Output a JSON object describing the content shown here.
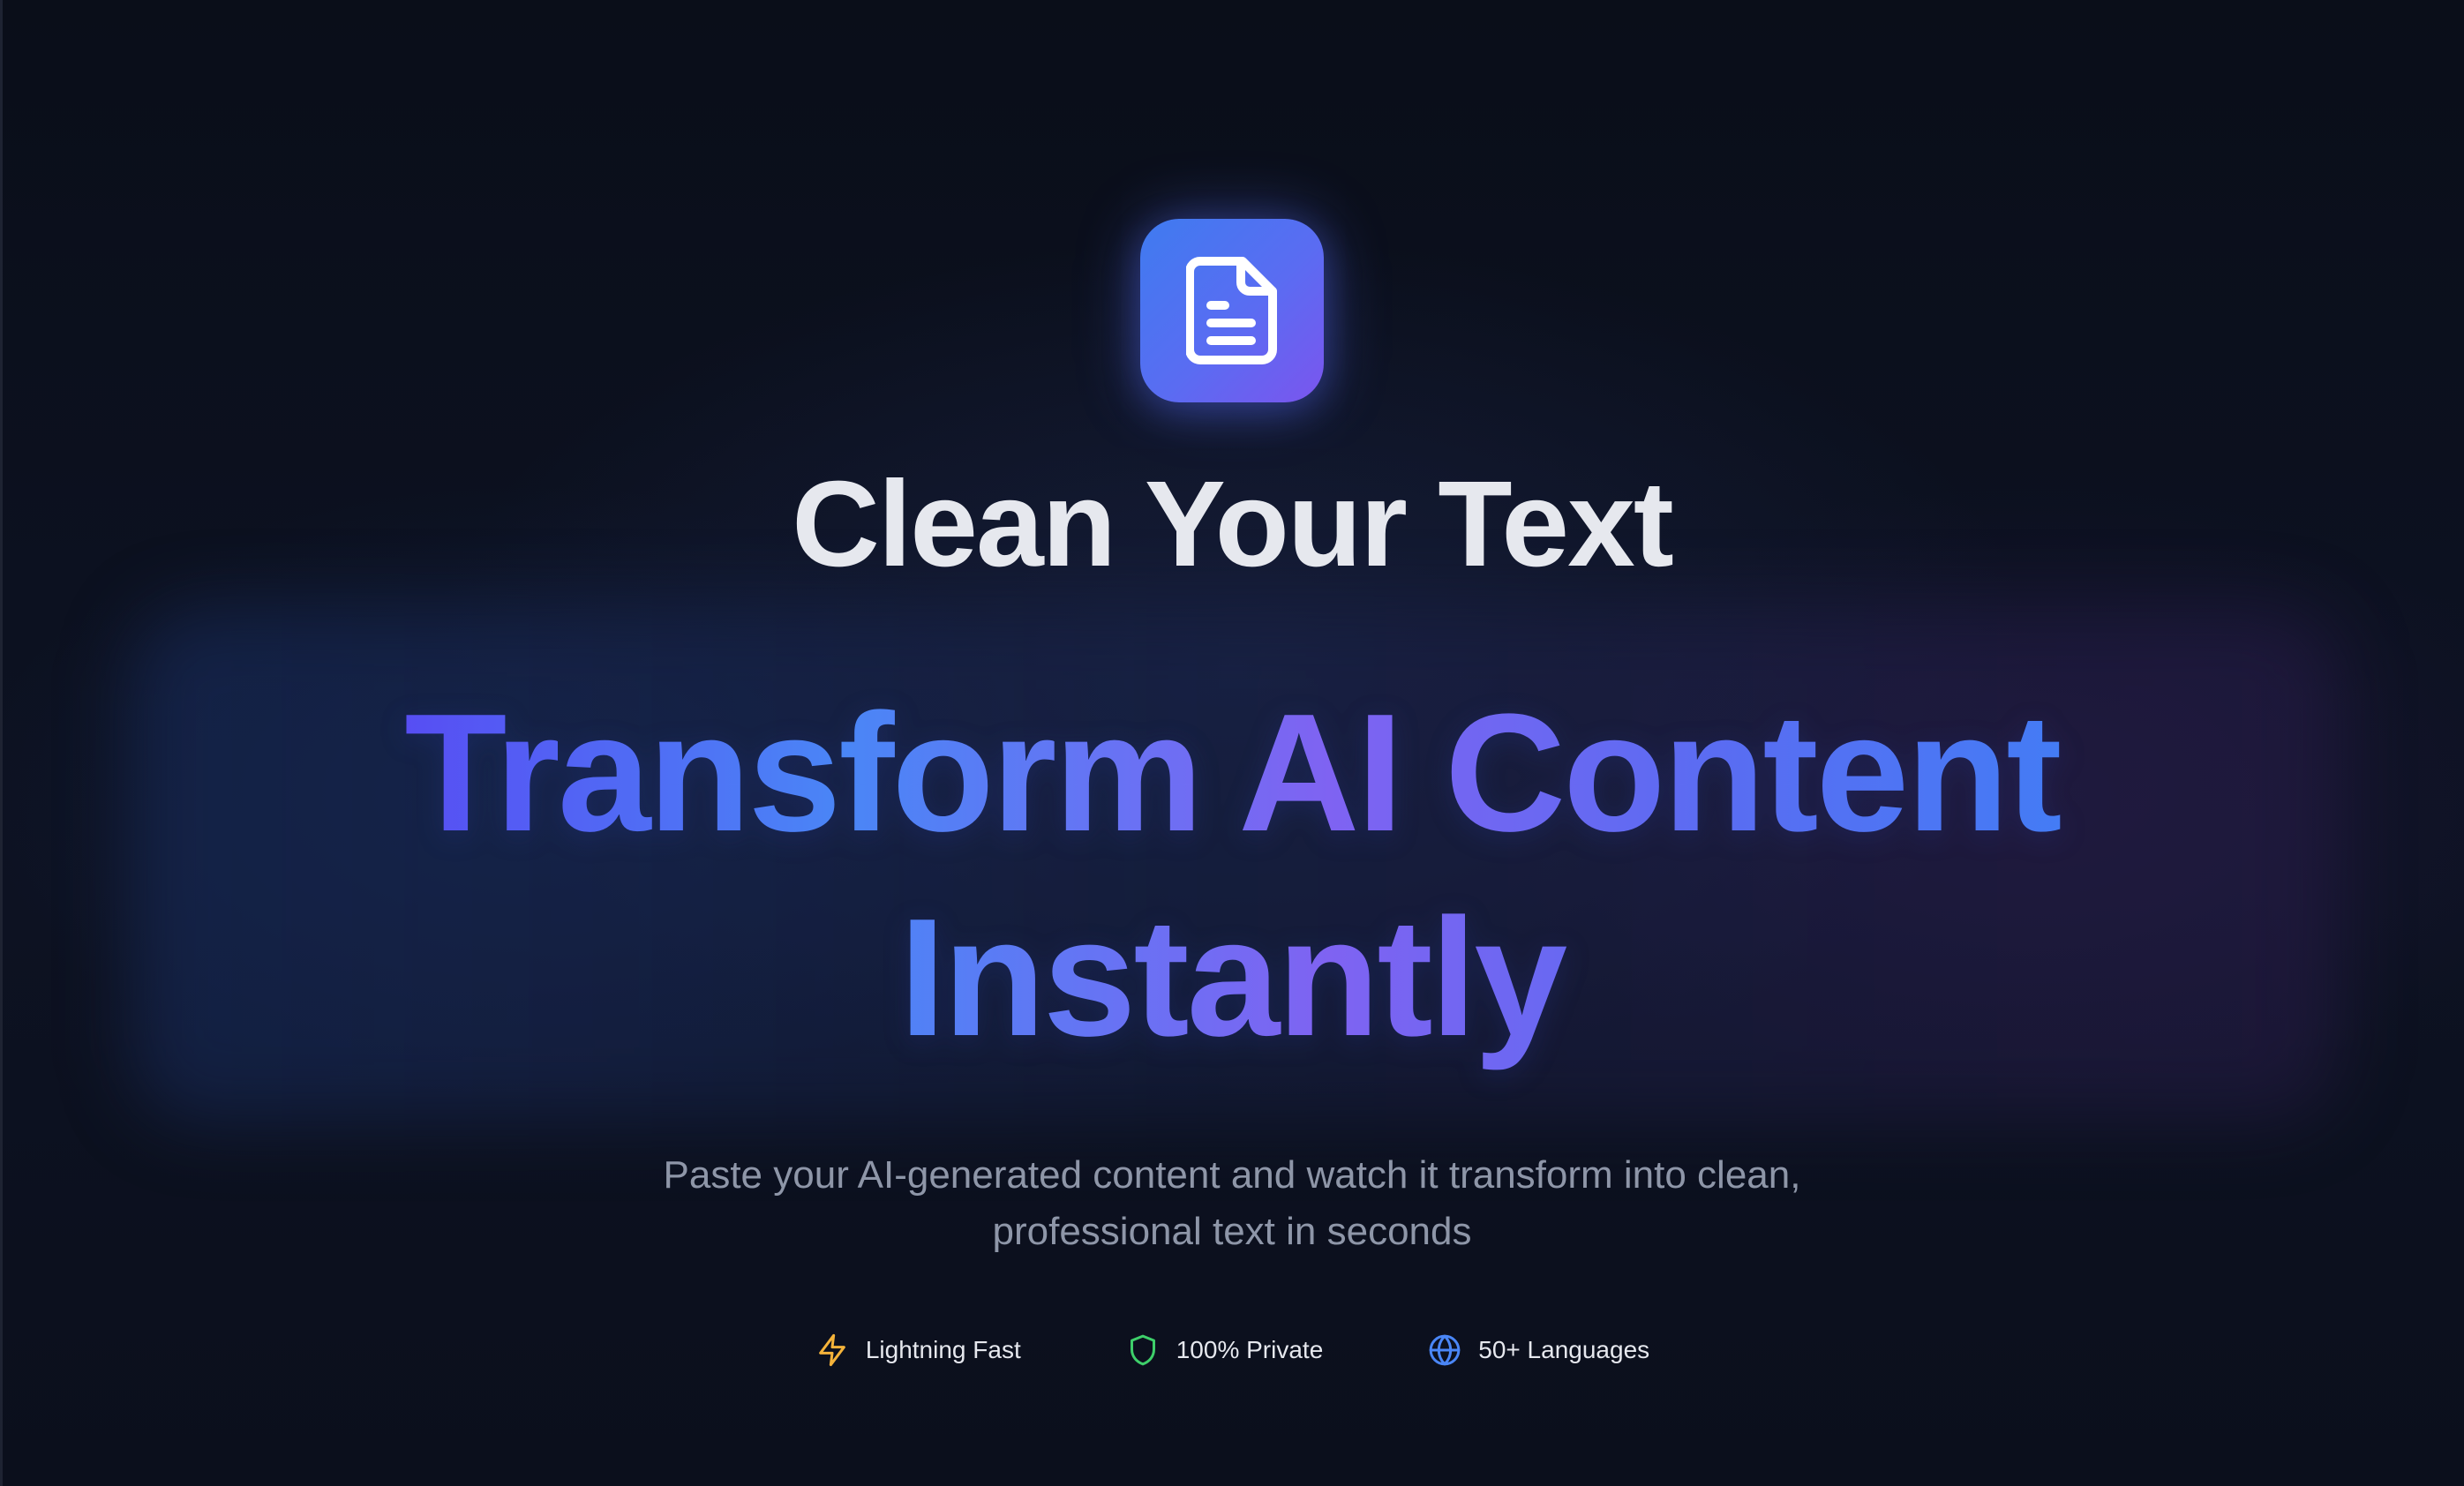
{
  "hero": {
    "title": "Clean Your Text",
    "headline_line1": "Transform AI Content",
    "headline_line2": "Instantly",
    "subtitle_line1": "Paste your AI-generated content and watch it transform into clean,",
    "subtitle_line2": "professional text in seconds"
  },
  "logo": {
    "icon": "document-icon",
    "gradient_start": "#3f7bf0",
    "gradient_end": "#7b55ee"
  },
  "features": [
    {
      "icon": "lightning-icon",
      "label": "Lightning Fast",
      "color": "#f5b33a"
    },
    {
      "icon": "shield-icon",
      "label": "100% Private",
      "color": "#3ecf6a"
    },
    {
      "icon": "globe-icon",
      "label": "50+ Languages",
      "color": "#4a86f6"
    }
  ],
  "colors": {
    "background": "#0b0f1c",
    "title_text": "#e6e8ee",
    "subtitle_text": "#8e96a8",
    "gradient_purple": "#5b3cf2",
    "gradient_blue": "#4a86f6",
    "gradient_violet": "#7f63f2"
  }
}
